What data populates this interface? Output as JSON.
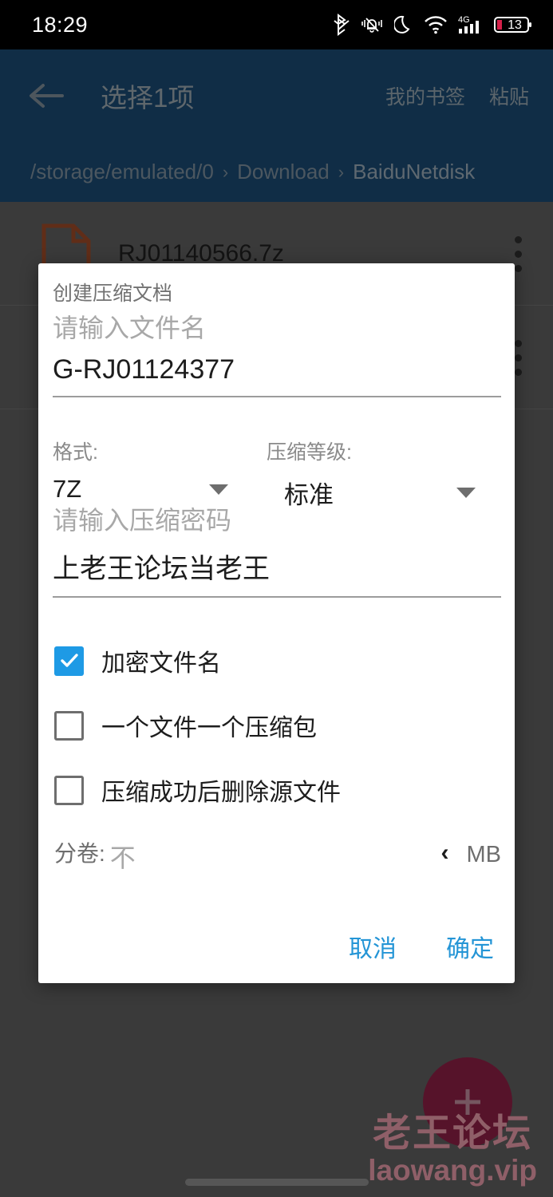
{
  "status_bar": {
    "time": "18:29",
    "battery_level": "13",
    "icons": [
      "bluetooth-icon",
      "silent-bell-icon",
      "do-not-disturb-moon-icon",
      "wifi-icon",
      "mobile-signal-4g-icon",
      "battery-icon"
    ],
    "network_type": "4G"
  },
  "header": {
    "back_icon": "back-arrow-icon",
    "title": "选择1项",
    "actions": [
      {
        "label": "我的书签"
      },
      {
        "label": "粘贴"
      }
    ],
    "breadcrumb": [
      {
        "label": "/storage/emulated/0"
      },
      {
        "label": "Download"
      },
      {
        "label": "BaiduNetdisk"
      }
    ],
    "breadcrumb_separator": "›",
    "bg_color": "#1b4a71"
  },
  "file_list": {
    "rows": [
      {
        "name": "RJ01140566.7z",
        "icon": "archive-7z-file-icon",
        "menu_icon": "overflow-menu-icon"
      },
      {
        "name": "",
        "icon": "archive-7z-file-icon",
        "menu_icon": "overflow-menu-icon"
      }
    ]
  },
  "fab": {
    "icon": "plus-icon",
    "color": "#8c1f45"
  },
  "watermark": {
    "cn": "老王论坛",
    "en": "laowang.vip",
    "color": "#e79aa8"
  },
  "dialog": {
    "title": "创建压缩文档",
    "filename": {
      "placeholder": "请输入文件名",
      "value": "G-RJ01124377"
    },
    "format": {
      "label": "格式:",
      "value": "7Z",
      "caret_icon": "chevron-down-icon"
    },
    "level": {
      "label": "压缩等级:",
      "value": "标准",
      "caret_icon": "chevron-down-icon"
    },
    "password": {
      "placeholder": "请输入压缩密码",
      "value": "上老王论坛当老王"
    },
    "checkboxes": [
      {
        "label": "加密文件名",
        "checked": true
      },
      {
        "label": "一个文件一个压缩包",
        "checked": false
      },
      {
        "label": "压缩成功后删除源文件",
        "checked": false
      }
    ],
    "split": {
      "label": "分卷:",
      "placeholder": "不",
      "chevron": "‹",
      "unit": "MB"
    },
    "buttons": {
      "cancel": "取消",
      "confirm": "确定",
      "color": "#2495d6"
    },
    "checked_color": "#1e9ae5"
  }
}
